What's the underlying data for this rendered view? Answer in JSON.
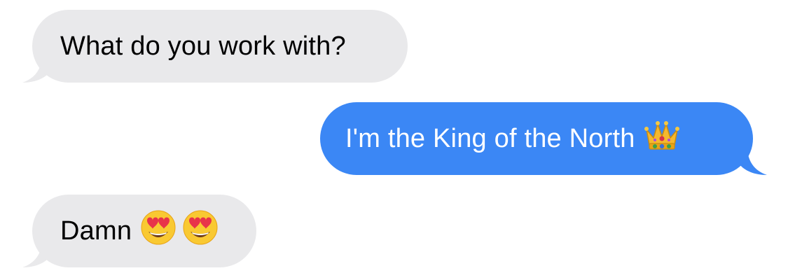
{
  "conversation": {
    "messages": [
      {
        "direction": "incoming",
        "text": "What do you work with?"
      },
      {
        "direction": "outgoing",
        "text": "I'm the King of the North",
        "emoji": "crown-emoji"
      },
      {
        "direction": "incoming",
        "text": "Damn",
        "emoji": [
          "heart-eyes-emoji",
          "heart-eyes-emoji"
        ]
      }
    ]
  },
  "colors": {
    "incoming_bubble": "#e9e9eb",
    "outgoing_bubble": "#3b87f5",
    "incoming_text": "#000000",
    "outgoing_text": "#ffffff"
  }
}
